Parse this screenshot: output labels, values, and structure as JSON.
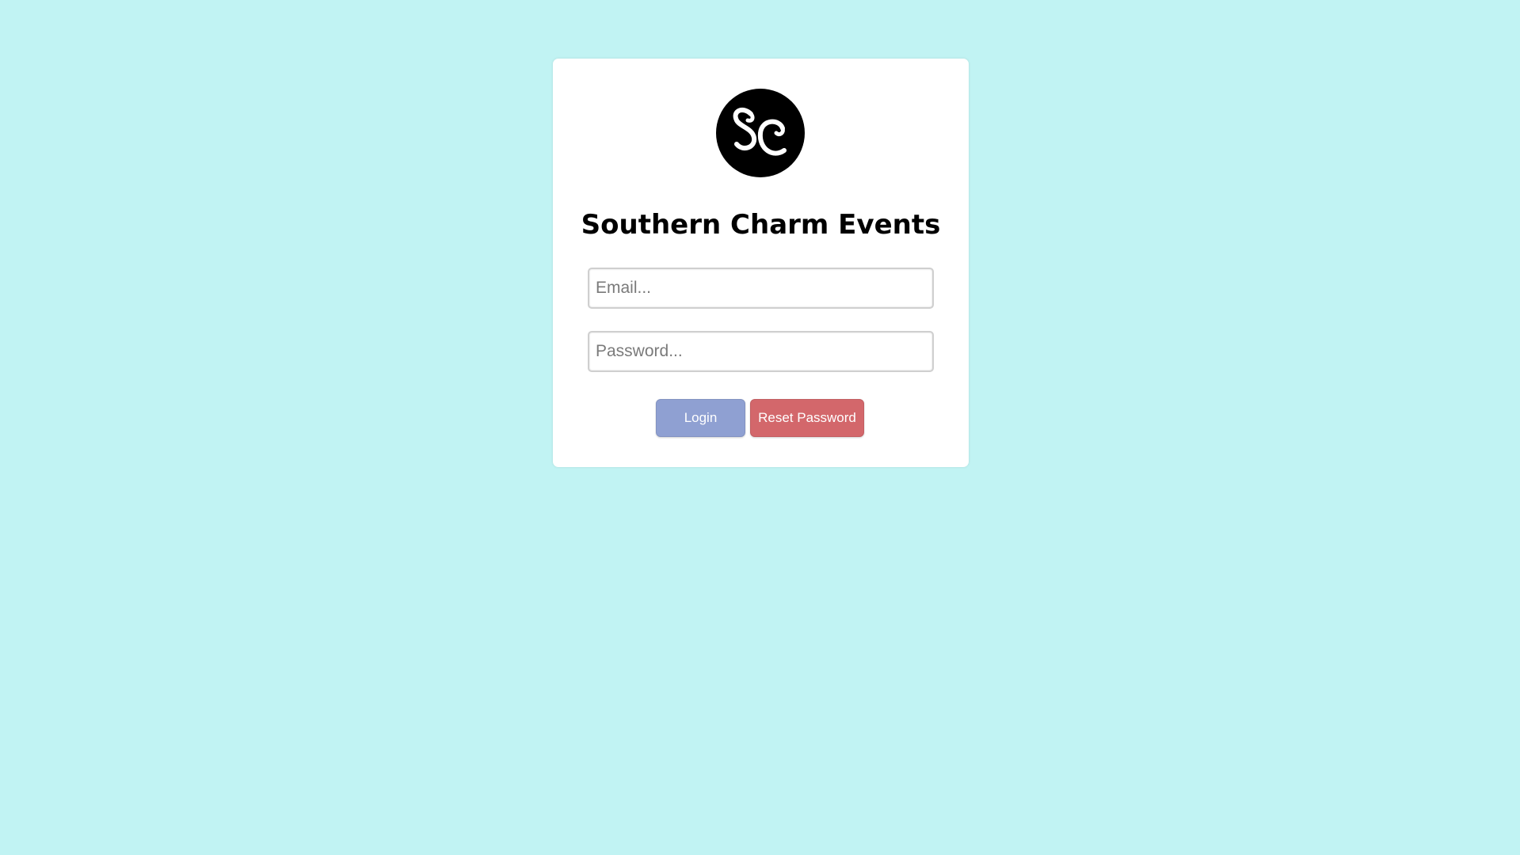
{
  "app": {
    "title": "Southern Charm Events",
    "logo_icon": "sc-monogram-logo"
  },
  "form": {
    "email_placeholder": "Email...",
    "email_value": "",
    "password_placeholder": "Password...",
    "password_value": ""
  },
  "buttons": {
    "login_label": "Login",
    "reset_label": "Reset Password"
  },
  "colors": {
    "background": "#c1f3f3",
    "card": "#ffffff",
    "login_button": "#8fa0d2",
    "reset_button": "#d3676b",
    "logo": "#000000"
  }
}
